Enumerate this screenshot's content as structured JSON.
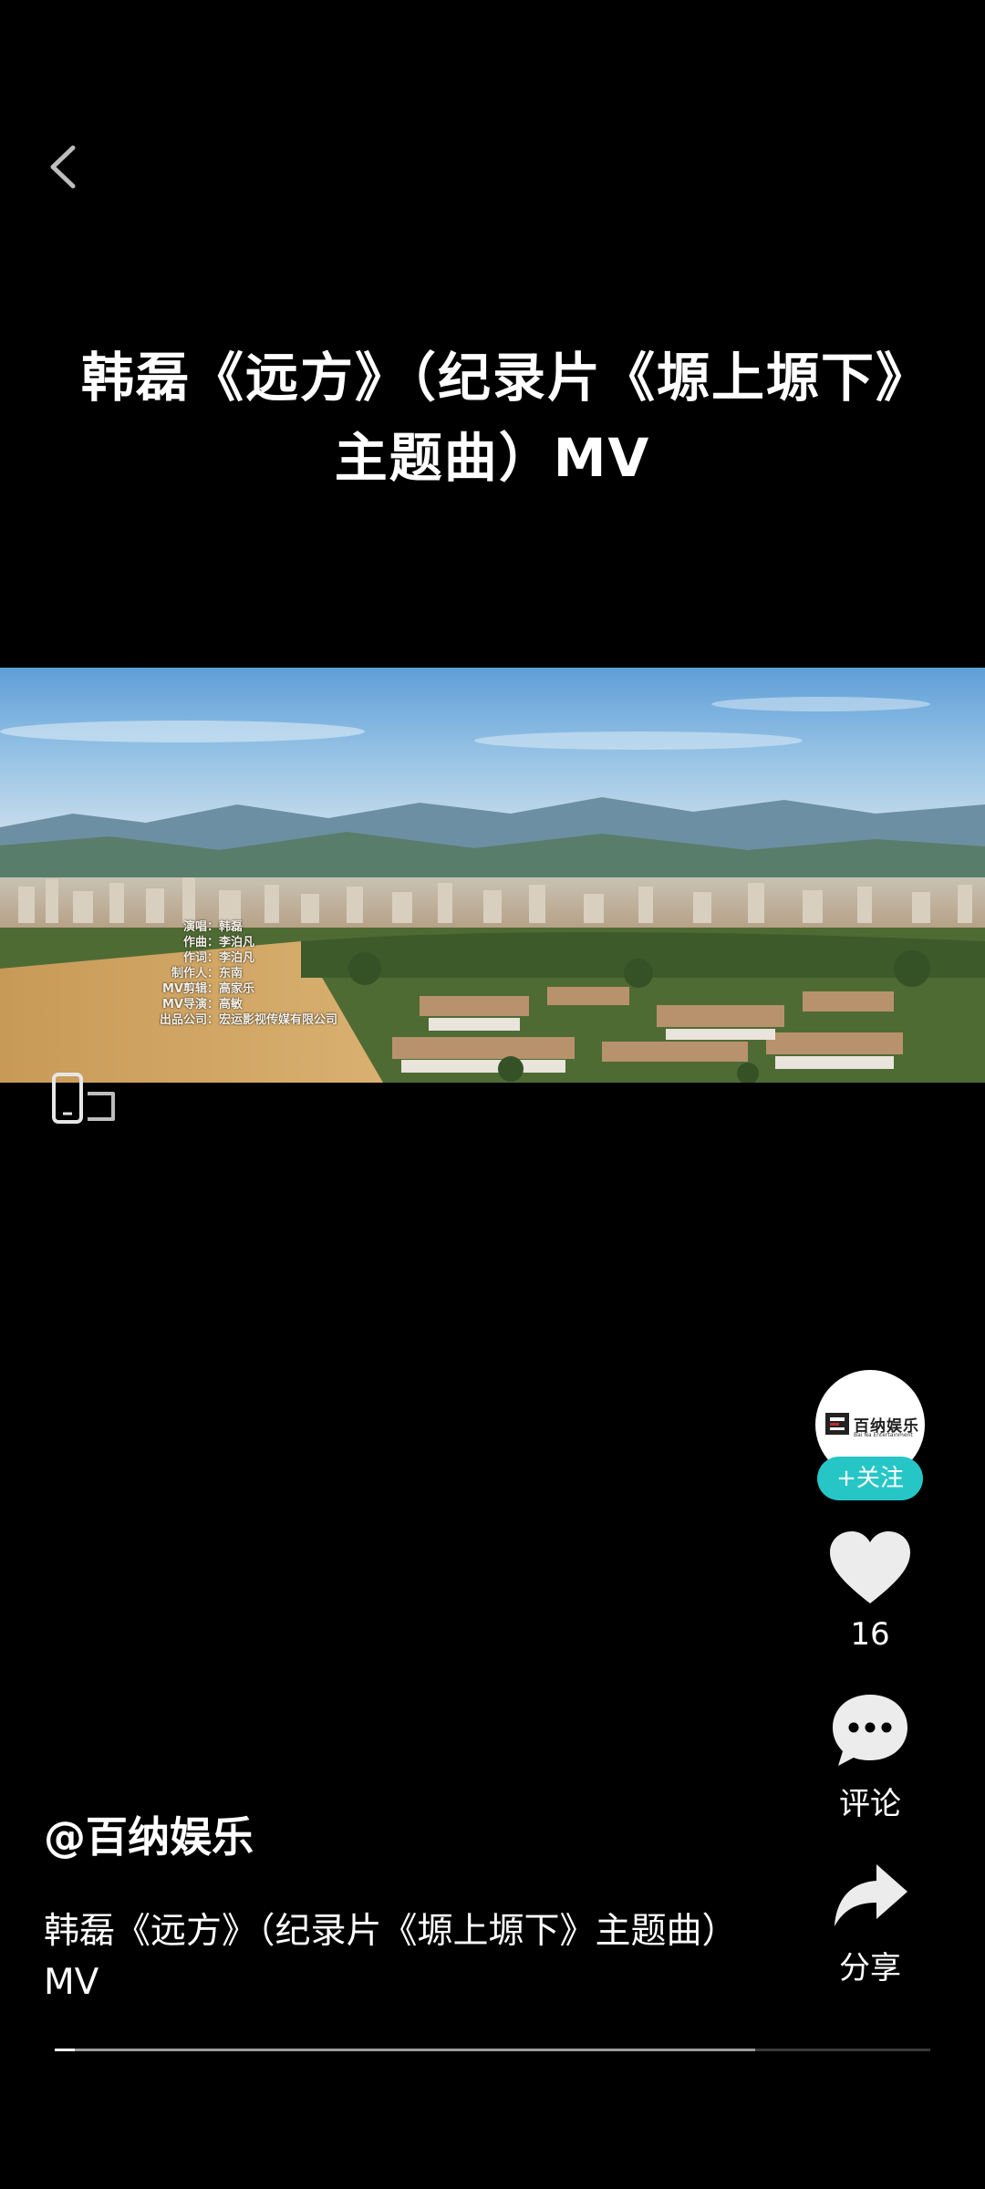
{
  "video": {
    "title": "韩磊《远方》（纪录片《塬上塬下》主题曲）MV",
    "credits": [
      {
        "key": "演唱：",
        "value": "韩磊"
      },
      {
        "key": "作曲：",
        "value": "李泊凡"
      },
      {
        "key": "作词：",
        "value": "李泊凡"
      },
      {
        "key": "制作人：",
        "value": "东南"
      },
      {
        "key": "MV剪辑：",
        "value": "高家乐"
      },
      {
        "key": "MV导演：",
        "value": "高敏"
      },
      {
        "key": "出品公司：",
        "value": "宏运影视传媒有限公司"
      }
    ],
    "progress_played": 0.023,
    "progress_loaded": 0.8
  },
  "author": {
    "handle": "@百纳娱乐",
    "avatar_logo_text": "百纳娱乐",
    "avatar_logo_sub": "Bai Na Entertainment"
  },
  "actions": {
    "follow_label": "+关注",
    "like_count": "16",
    "comment_label": "评论",
    "share_label": "分享"
  },
  "description": "韩磊《远方》（纪录片《塬上塬下》主题曲）MV",
  "icons": [
    "back-chevron-icon",
    "rotate-screen-icon",
    "heart-icon",
    "comment-bubble-icon",
    "share-arrow-icon"
  ],
  "colors": {
    "background": "#000000",
    "follow_accent": "#26c6c6"
  }
}
